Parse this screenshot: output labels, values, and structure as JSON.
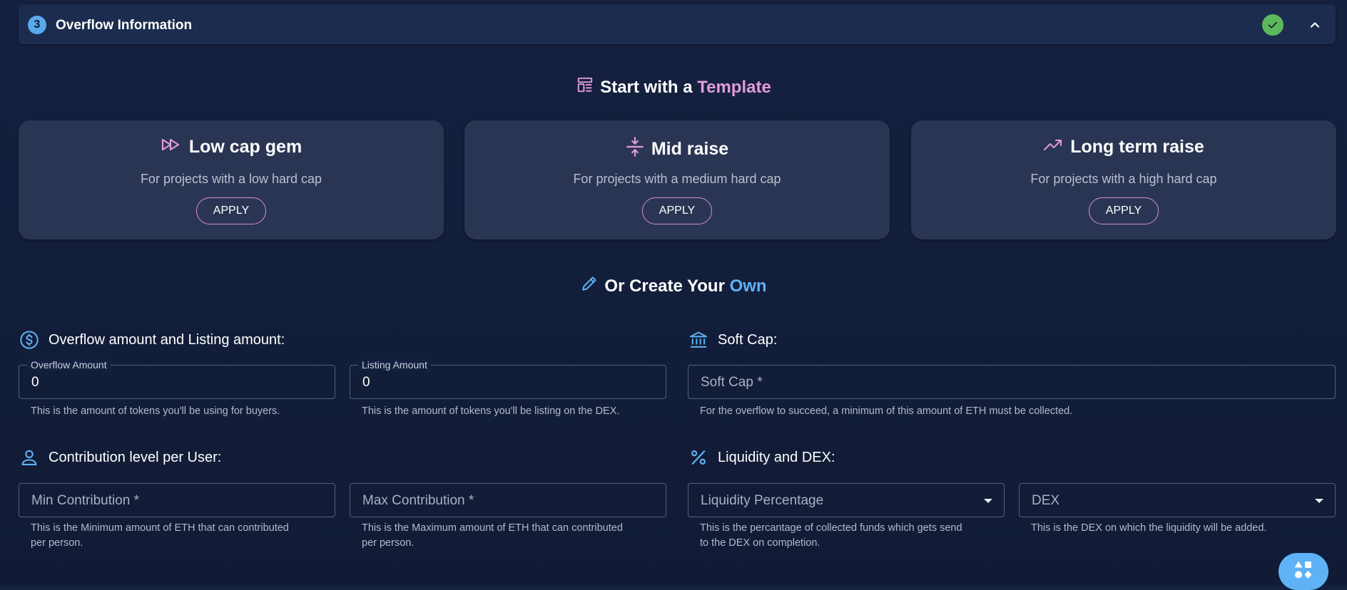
{
  "accordion": {
    "step_number": "3",
    "title": "Overflow Information"
  },
  "templates_section": {
    "heading_prefix": "Start with a",
    "heading_accent": "Template",
    "cards": [
      {
        "title": "Low cap gem",
        "description": "For projects with a low hard cap",
        "button": "APPLY",
        "icon": "fast-forward-icon"
      },
      {
        "title": "Mid raise",
        "description": "For projects with a medium hard cap",
        "button": "APPLY",
        "icon": "compress-icon"
      },
      {
        "title": "Long term raise",
        "description": "For projects with a high hard cap",
        "button": "APPLY",
        "icon": "trending-up-icon"
      }
    ]
  },
  "custom_section": {
    "heading_prefix": "Or Create Your",
    "heading_accent": "Own"
  },
  "groups": {
    "amounts": {
      "heading": "Overflow amount and Listing amount:",
      "overflow_label": "Overflow Amount",
      "overflow_value": "0",
      "overflow_helper": "This is the amount of tokens you'll be using for buyers.",
      "listing_label": "Listing Amount",
      "listing_value": "0",
      "listing_helper": "This is the amount of tokens you'll be listing on the DEX."
    },
    "soft_cap": {
      "heading": "Soft Cap:",
      "placeholder": "Soft Cap *",
      "helper": "For the overflow to succeed, a minimum of this amount of ETH must be collected."
    },
    "contribution": {
      "heading": "Contribution level per User:",
      "min_placeholder": "Min Contribution *",
      "min_helper_1": "This is the Minimum amount of ETH that can contributed",
      "min_helper_2": "per person.",
      "max_placeholder": "Max Contribution *",
      "max_helper_1": "This is the Maximum amount of ETH that can contributed",
      "max_helper_2": "per person."
    },
    "liquidity": {
      "heading": "Liquidity and DEX:",
      "percentage_placeholder": "Liquidity Percentage",
      "percentage_helper_1": "This is the percantage of collected funds which gets send",
      "percentage_helper_2": "to the DEX on completion.",
      "dex_placeholder": "DEX",
      "dex_helper": "This is the DEX on which the liquidity will be added."
    }
  },
  "colors": {
    "accent_pink": "#e29bd9",
    "accent_blue": "#5eb2f5",
    "success_green": "#5cb85c"
  }
}
